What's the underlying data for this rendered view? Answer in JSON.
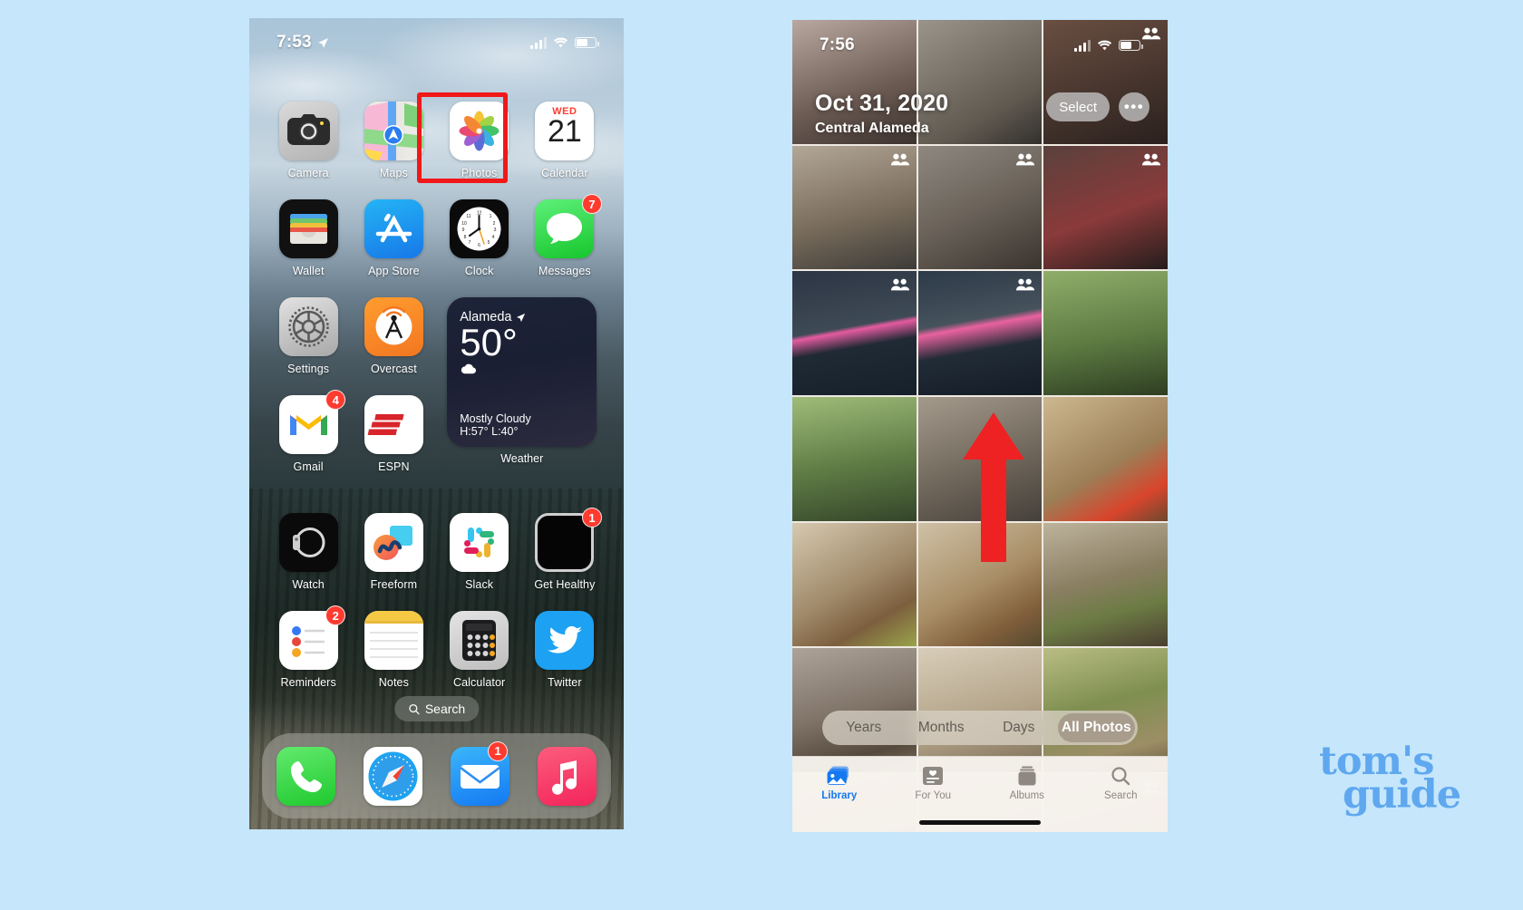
{
  "page": {
    "background_color": "#c5e6fb",
    "watermark": {
      "line1": "tom's",
      "line2": "guide",
      "color": "#5fa8ef"
    }
  },
  "left_phone": {
    "name": "iphone-home-screen",
    "status_bar": {
      "time": "7:53",
      "location_icon": "location-arrow-icon",
      "cellular_icon": "signal-bars-icon",
      "wifi_icon": "wifi-icon",
      "battery_icon": "battery-icon"
    },
    "highlight": {
      "target": "Photos",
      "color": "#f01818"
    },
    "apps": [
      {
        "label": "Camera",
        "icon": "camera-icon",
        "badge": ""
      },
      {
        "label": "Maps",
        "icon": "maps-icon",
        "badge": ""
      },
      {
        "label": "Photos",
        "icon": "photos-icon",
        "badge": "",
        "highlighted": true
      },
      {
        "label": "Calendar",
        "icon": "calendar-icon",
        "badge": "",
        "day_name": "WED",
        "day_number": "21"
      },
      {
        "label": "Wallet",
        "icon": "wallet-icon",
        "badge": ""
      },
      {
        "label": "App Store",
        "icon": "app-store-icon",
        "badge": ""
      },
      {
        "label": "Clock",
        "icon": "clock-icon",
        "badge": ""
      },
      {
        "label": "Messages",
        "icon": "messages-icon",
        "badge": "7"
      },
      {
        "label": "Settings",
        "icon": "settings-gear-icon",
        "badge": ""
      },
      {
        "label": "Overcast",
        "icon": "overcast-icon",
        "badge": ""
      },
      {
        "label": "Gmail",
        "icon": "gmail-icon",
        "badge": "4"
      },
      {
        "label": "ESPN",
        "icon": "espn-icon",
        "badge": ""
      },
      {
        "label": "Watch",
        "icon": "watch-icon",
        "badge": ""
      },
      {
        "label": "Freeform",
        "icon": "freeform-icon",
        "badge": ""
      },
      {
        "label": "Slack",
        "icon": "slack-icon",
        "badge": ""
      },
      {
        "label": "Get Healthy",
        "icon": "get-healthy-icon",
        "badge": "1"
      },
      {
        "label": "Reminders",
        "icon": "reminders-icon",
        "badge": "2"
      },
      {
        "label": "Notes",
        "icon": "notes-icon",
        "badge": ""
      },
      {
        "label": "Calculator",
        "icon": "calculator-icon",
        "badge": ""
      },
      {
        "label": "Twitter",
        "icon": "twitter-icon",
        "badge": ""
      }
    ],
    "weather_widget": {
      "label": "Weather",
      "city": "Alameda",
      "temperature": "50°",
      "condition": "Mostly Cloudy",
      "high_low": "H:57° L:40°",
      "condition_icon": "cloud-icon",
      "location_icon": "location-arrow-icon"
    },
    "search_pill": {
      "label": "Search",
      "icon": "search-icon"
    },
    "dock": [
      {
        "label": "Phone",
        "icon": "phone-icon",
        "badge": ""
      },
      {
        "label": "Safari",
        "icon": "safari-icon",
        "badge": ""
      },
      {
        "label": "Mail",
        "icon": "mail-icon",
        "badge": "1"
      },
      {
        "label": "Music",
        "icon": "music-icon",
        "badge": ""
      }
    ]
  },
  "right_phone": {
    "name": "photos-app-library",
    "status_bar": {
      "time": "7:56",
      "cellular_icon": "signal-bars-icon",
      "wifi_icon": "wifi-icon",
      "battery_icon": "battery-icon"
    },
    "header": {
      "date": "Oct 31, 2020",
      "place": "Central Alameda",
      "select_label": "Select",
      "more_label": "•••"
    },
    "segmented_control": {
      "options": [
        "Years",
        "Months",
        "Days",
        "All Photos"
      ],
      "selected": "All Photos"
    },
    "tab_bar": [
      {
        "label": "Library",
        "icon": "photos-library-icon",
        "active": true
      },
      {
        "label": "For You",
        "icon": "for-you-icon",
        "active": false
      },
      {
        "label": "Albums",
        "icon": "albums-icon",
        "active": false
      },
      {
        "label": "Search",
        "icon": "search-icon",
        "active": false
      }
    ],
    "annotation": {
      "type": "up-arrow",
      "color": "#ee2222"
    },
    "grid": {
      "columns": 3,
      "thumbnails": [
        {
          "row": 1,
          "col": 1,
          "tone": "#8a7a72",
          "shared": false
        },
        {
          "row": 1,
          "col": 2,
          "tone": "#736b63",
          "shared": false
        },
        {
          "row": 1,
          "col": 3,
          "tone": "#4a3f3c",
          "shared": true
        },
        {
          "row": 2,
          "col": 1,
          "tone": "#7e7367",
          "shared": true
        },
        {
          "row": 2,
          "col": 2,
          "tone": "#6e6a62",
          "shared": true
        },
        {
          "row": 2,
          "col": 3,
          "tone": "#3d3431",
          "shared": true
        },
        {
          "row": 3,
          "col": 1,
          "tone": "#2d3540",
          "shared": true
        },
        {
          "row": 3,
          "col": 2,
          "tone": "#31383f",
          "shared": true
        },
        {
          "row": 3,
          "col": 3,
          "tone": "#6a7a4a",
          "shared": false
        },
        {
          "row": 4,
          "col": 1,
          "tone": "#5d6b3f",
          "shared": false
        },
        {
          "row": 4,
          "col": 2,
          "tone": "#6a6259",
          "shared": false
        },
        {
          "row": 4,
          "col": 3,
          "tone": "#a08f6f",
          "shared": false
        },
        {
          "row": 5,
          "col": 1,
          "tone": "#9c8f78",
          "shared": false
        },
        {
          "row": 5,
          "col": 2,
          "tone": "#a39377",
          "shared": false
        },
        {
          "row": 5,
          "col": 3,
          "tone": "#8d7f68",
          "shared": false
        },
        {
          "row": 6,
          "col": 1,
          "tone": "#8b8276",
          "shared": false
        },
        {
          "row": 6,
          "col": 2,
          "tone": "#b9ab96",
          "shared": false
        },
        {
          "row": 6,
          "col": 3,
          "tone": "#9d9a72",
          "shared": false
        },
        {
          "row": 7,
          "col": 1,
          "tone": "#cbbfae",
          "shared": false
        },
        {
          "row": 7,
          "col": 2,
          "tone": "#c4b9a8",
          "shared": true
        },
        {
          "row": 7,
          "col": 3,
          "tone": "#bdb2a0",
          "shared": true
        }
      ]
    }
  }
}
